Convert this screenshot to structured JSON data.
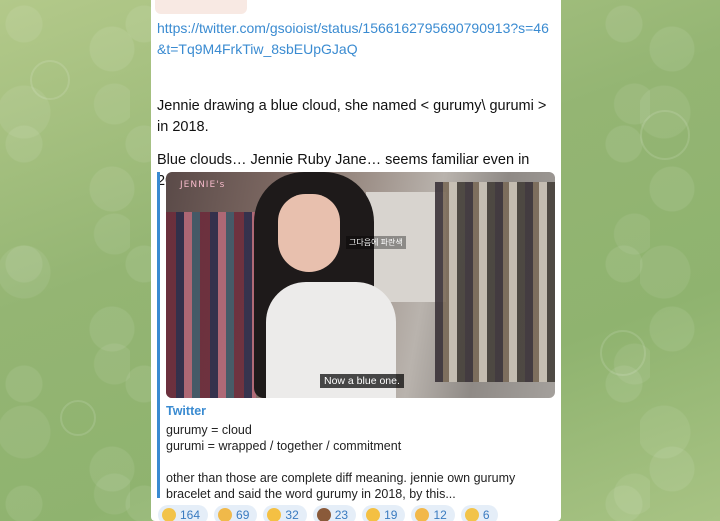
{
  "message": {
    "link": "https://twitter.com/gsoioist/status/1566162795690790913?s=46&t=Tq9M4FrkTiw_8sbEUpGJaQ",
    "paragraph1": "Jennie drawing a blue cloud, she named < gurumy\\ gurumi > in 2018.",
    "paragraph2": "Blue clouds… Jennie Ruby Jane… seems familiar even in 2022."
  },
  "preview": {
    "logo_text": "JENNIE's",
    "kr_caption": "그다음에 파란색",
    "video_caption": "Now a blue one.",
    "source": "Twitter",
    "line1": "gurumy = cloud",
    "line2": "gurumi = wrapped / together / commitment",
    "line3": "other than those are complete diff meaning. jennie own gurumy bracelet and said the word gurumy in 2018, by this..."
  },
  "reactions": [
    {
      "icon": "thinking-face-icon",
      "count": "164",
      "color": "#f2c34a"
    },
    {
      "icon": "hugging-face-icon",
      "count": "69",
      "color": "#f0b94a"
    },
    {
      "icon": "thumbs-up-icon",
      "count": "32",
      "color": "#f4c043"
    },
    {
      "icon": "poop-icon",
      "count": "23",
      "color": "#8a5a3a"
    },
    {
      "icon": "pointing-finger-icon",
      "count": "19",
      "color": "#f4c043"
    },
    {
      "icon": "screaming-face-icon",
      "count": "12",
      "color": "#f2b84a"
    },
    {
      "icon": "neutral-face-icon",
      "count": "6",
      "color": "#f2c34a"
    }
  ]
}
